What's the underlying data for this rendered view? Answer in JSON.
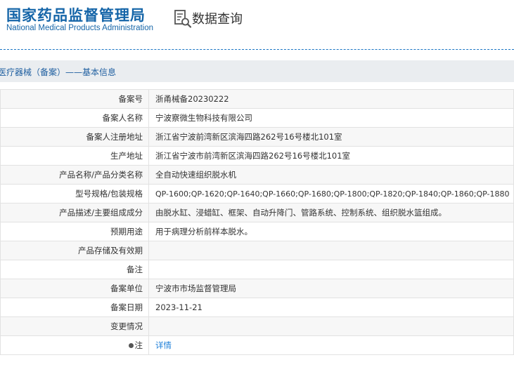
{
  "header": {
    "logo_cn": "国家药品监督管理局",
    "logo_en": "National Medical Products Administration",
    "query_icon": "document-search-icon",
    "query_title": "数据查询"
  },
  "section": {
    "title": "医疗器械（备案）——基本信息"
  },
  "rows": [
    {
      "label": "备案号",
      "value": "浙甬械备20230222"
    },
    {
      "label": "备案人名称",
      "value": "宁波察微生物科技有限公司"
    },
    {
      "label": "备案人注册地址",
      "value": "浙江省宁波前湾新区滨海四路262号16号楼北101室"
    },
    {
      "label": "生产地址",
      "value": "浙江省宁波市前湾新区滨海四路262号16号楼北101室"
    },
    {
      "label": "产品名称/产品分类名称",
      "value": "全自动快速组织脱水机"
    },
    {
      "label": "型号规格/包装规格",
      "value": "QP-1600;QP-1620;QP-1640;QP-1660;QP-1680;QP-1800;QP-1820;QP-1840;QP-1860;QP-1880"
    },
    {
      "label": "产品描述/主要组成成分",
      "value": "由脱水缸、浸蜡缸、框架、自动升降门、管路系统、控制系统、组织脱水篮组成。"
    },
    {
      "label": "预期用途",
      "value": "用于病理分析前样本脱水。"
    },
    {
      "label": "产品存储及有效期",
      "value": ""
    },
    {
      "label": "备注",
      "value": ""
    },
    {
      "label": "备案单位",
      "value": "宁波市市场监督管理局"
    },
    {
      "label": "备案日期",
      "value": "2023-11-21"
    },
    {
      "label": "变更情况",
      "value": ""
    },
    {
      "label": "注",
      "value": "详情",
      "icon": "dot-icon"
    }
  ]
}
